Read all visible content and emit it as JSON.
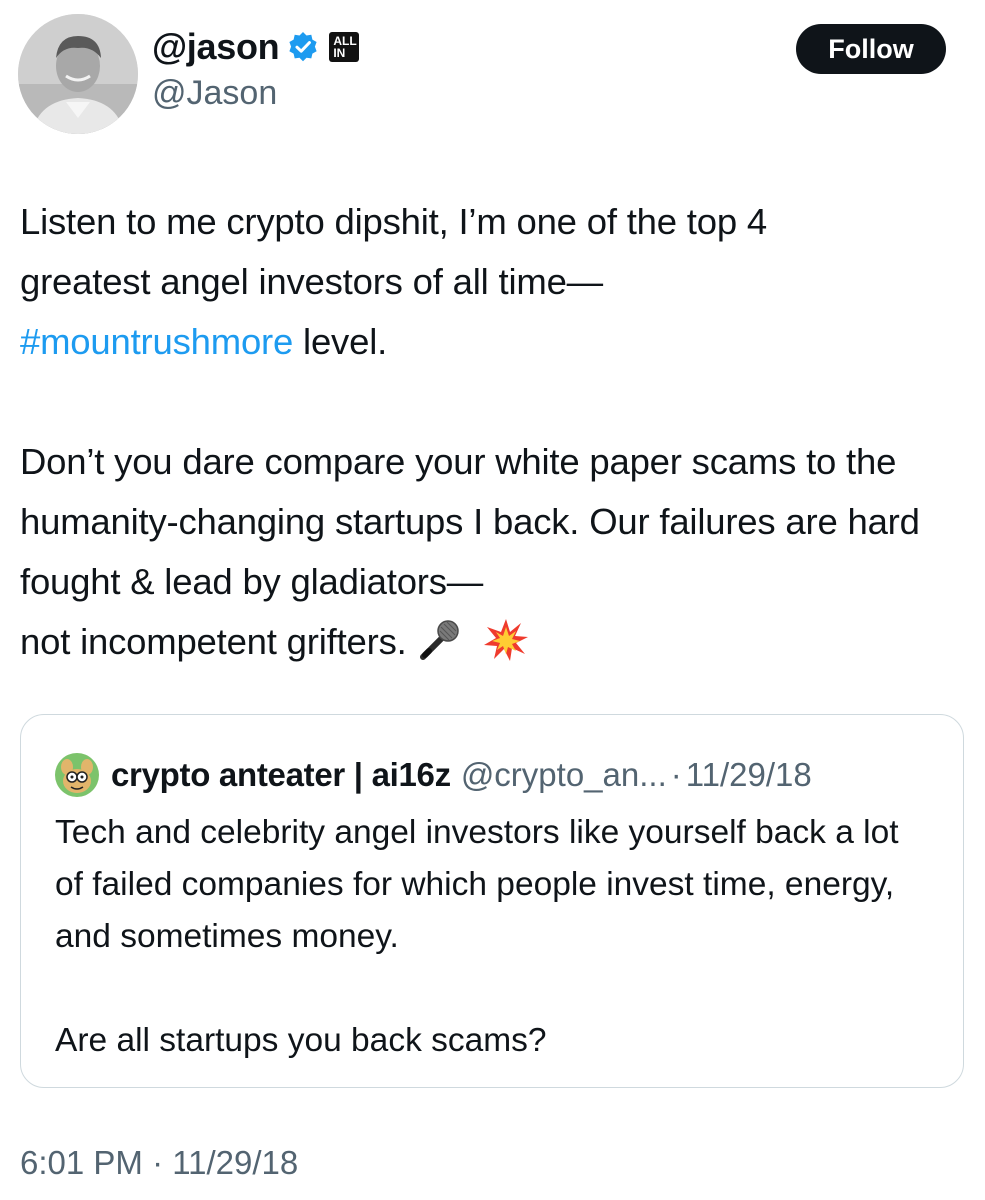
{
  "author": {
    "display_name": "@jason",
    "handle": "@Jason",
    "verified": true,
    "affiliate_badge": {
      "line1": "ALL",
      "line2": "IN"
    },
    "avatar_icon": "profile-photo"
  },
  "follow_label": "Follow",
  "tweet": {
    "line1": "Listen to me crypto dipshit, I’m one of the top 4",
    "line2": "greatest angel investors of all time—",
    "hashtag": "#mountrushmore",
    "line3_rest": " level.",
    "para2": "Don’t you dare compare your white paper scams to the humanity-changing startups I back. Our failures are hard fought & lead by gladiators—",
    "para2_last": "not incompetent grifters.",
    "emojis": [
      "microphone-emoji",
      "collision-emoji"
    ]
  },
  "quoted_tweet": {
    "display_name": "crypto anteater | ai16z",
    "handle": "@crypto_an...",
    "separator": "·",
    "date": "11/29/18",
    "text1": "Tech and celebrity angel investors like yourself back a lot of failed companies for which people invest time, energy, and sometimes money.",
    "text2": "Are all startups you back scams?",
    "avatar_icon": "cartoon-anteater-avatar"
  },
  "timestamp": {
    "time": "6:01 PM",
    "separator": "·",
    "date": "11/29/18"
  },
  "colors": {
    "text": "#0f1419",
    "secondary": "#536471",
    "link": "#1d9bf0",
    "border": "#cfd9de",
    "button_bg": "#0f1419"
  }
}
